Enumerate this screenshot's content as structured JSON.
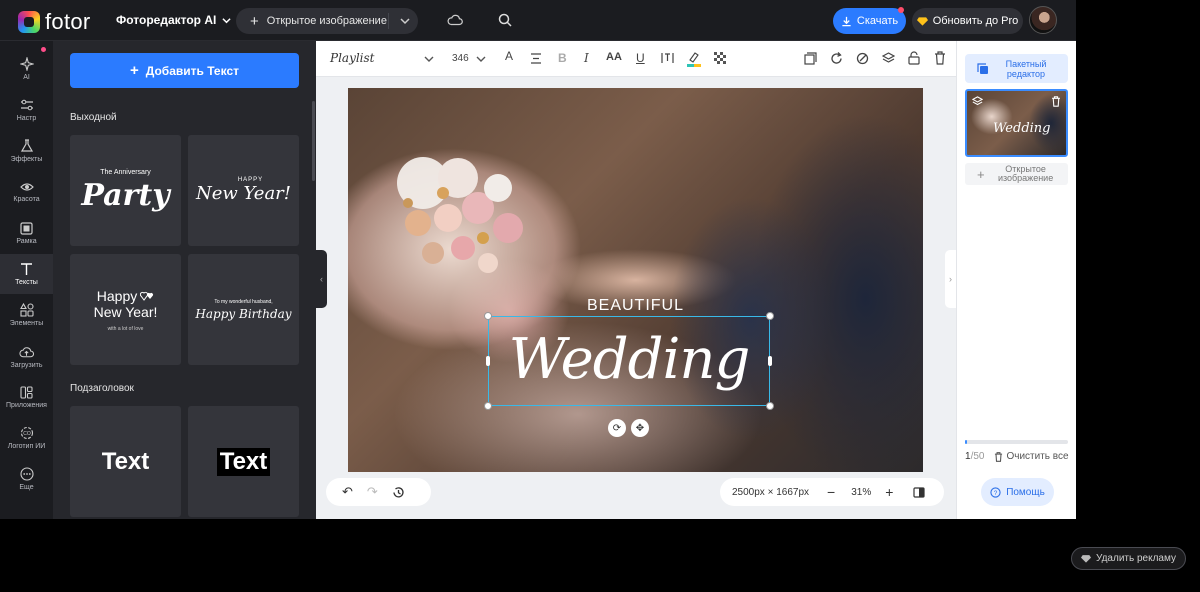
{
  "header": {
    "logo_text": "fotor",
    "editor_menu": "Фоторедактор AI",
    "open_image": "Открытое изображение",
    "download": "Скачать",
    "upgrade": "Обновить до Pro"
  },
  "rail": [
    {
      "label": "AI",
      "icon": "ai-icon"
    },
    {
      "label": "Настр",
      "icon": "adjust-icon"
    },
    {
      "label": "Эффекты",
      "icon": "effects-icon"
    },
    {
      "label": "Красота",
      "icon": "beauty-icon"
    },
    {
      "label": "Рамка",
      "icon": "frame-icon"
    },
    {
      "label": "Тексты",
      "icon": "text-icon",
      "active": true
    },
    {
      "label": "Элементы",
      "icon": "elements-icon"
    },
    {
      "label": "Загрузить",
      "icon": "upload-icon"
    },
    {
      "label": "Приложения",
      "icon": "apps-icon"
    },
    {
      "label": "Логотип ИИ",
      "icon": "ai-logo-icon"
    },
    {
      "label": "Еще",
      "icon": "more-icon"
    }
  ],
  "panel": {
    "add_text": "Добавить Текст",
    "section_holiday": "Выходной",
    "section_subheading": "Подзаголовок",
    "cards": {
      "party_small": "The Anniversary",
      "party_big": "Party",
      "newyear_small": "HAPPY",
      "newyear_big": "New Year!",
      "hny_line1": "Happy",
      "hny_line2": "New Year!",
      "hny_small": "with a lot of love",
      "bday_small": "To my wonderful husband,",
      "bday_big": "Happy Birthday",
      "text_plain": "Text",
      "text_boxed": "Text"
    }
  },
  "toolbar": {
    "font": "Playlist",
    "size": "346"
  },
  "canvas": {
    "beautiful": "BEAUTIFUL",
    "wedding": "Wedding",
    "dimensions": "2500px × 1667px",
    "zoom": "31%"
  },
  "right_panel": {
    "batch_editor": "Пакетный редактор",
    "open_image": "Открытое изображение",
    "counter_current": "1",
    "counter_total": "/50",
    "clear_all": "Очистить все",
    "progress_fraction": 0.02,
    "help": "Помощь"
  },
  "ad": {
    "remove_ads": "Удалить рекламу"
  }
}
